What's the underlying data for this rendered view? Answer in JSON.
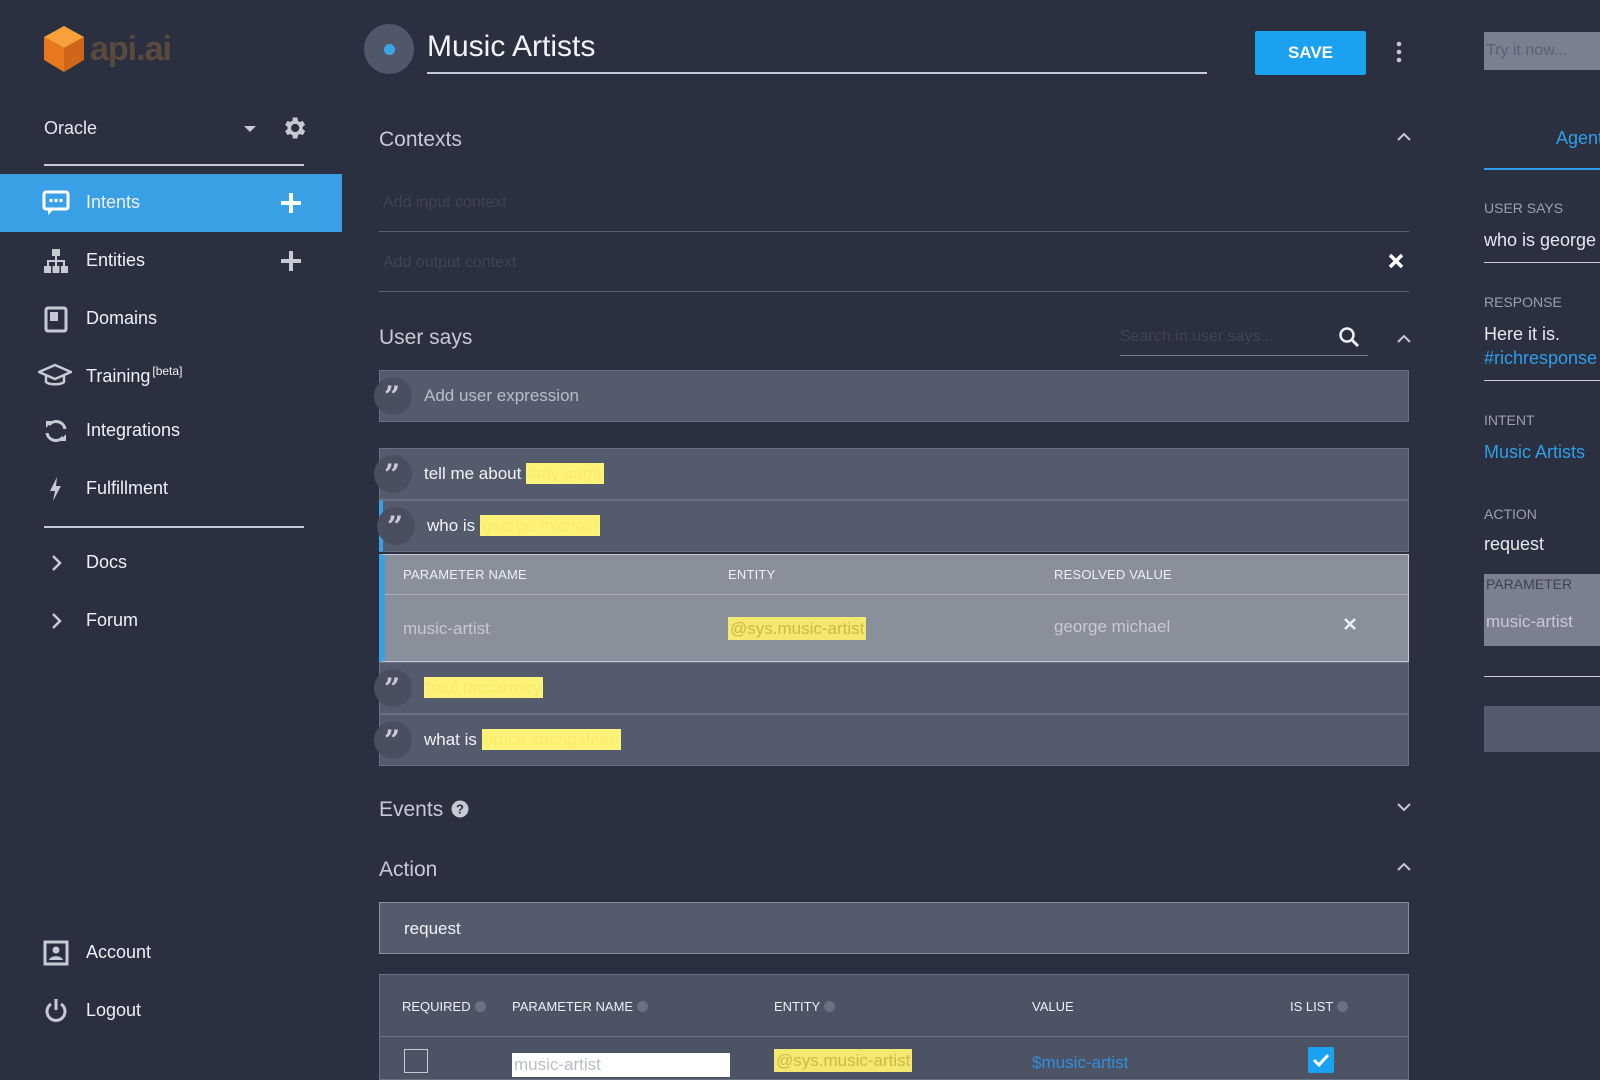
{
  "brand": {
    "logo_text": "api.ai",
    "accent": "#39a0e5",
    "save_color": "#1aa1ef",
    "highlight": "#fdf27a"
  },
  "sidebar": {
    "agent_name": "Oracle",
    "items": [
      {
        "label": "Intents",
        "icon": "intents-icon",
        "active": true
      },
      {
        "label": "Entities",
        "icon": "entities-icon"
      },
      {
        "label": "Domains",
        "icon": "domains-icon"
      },
      {
        "label": "Training",
        "badge": "[beta]",
        "icon": "training-icon"
      },
      {
        "label": "Integrations",
        "icon": "integrations-icon"
      },
      {
        "label": "Fulfillment",
        "icon": "fulfillment-icon"
      },
      {
        "label": "Docs",
        "icon": "chevron-right-icon"
      },
      {
        "label": "Forum",
        "icon": "chevron-right-icon"
      },
      {
        "label": "Account",
        "icon": "account-icon"
      },
      {
        "label": "Logout",
        "icon": "power-icon"
      }
    ]
  },
  "header": {
    "intent_name": "Music Artists",
    "save_label": "SAVE"
  },
  "contexts": {
    "title": "Contexts",
    "input_placeholder": "Add input context",
    "output_placeholder": "Add output context"
  },
  "user_says": {
    "title": "User says",
    "search_placeholder": "Search in user says...",
    "add_placeholder": "Add user expression",
    "expressions": [
      {
        "prefix": "tell me about ",
        "entity": "lady gaga"
      },
      {
        "prefix": "who is ",
        "entity": "george michael"
      },
      {
        "prefix": "",
        "entity": "paul mccartney"
      },
      {
        "prefix": "what is ",
        "entity": "bruce springsteen"
      }
    ],
    "param_table": {
      "headers": [
        "PARAMETER NAME",
        "ENTITY",
        "RESOLVED VALUE"
      ],
      "row": {
        "name": "music-artist",
        "entity": "@sys.music-artist",
        "resolved": "george michael"
      }
    }
  },
  "events": {
    "title": "Events"
  },
  "action": {
    "title": "Action",
    "value": "request",
    "table": {
      "headers": [
        "REQUIRED",
        "PARAMETER NAME",
        "ENTITY",
        "VALUE",
        "IS LIST"
      ],
      "row": {
        "required": false,
        "name": "music-artist",
        "entity": "@sys.music-artist",
        "value": "$music-artist",
        "is_list": true
      }
    }
  },
  "right_panel": {
    "try_placeholder": "Try it now...",
    "tab": "Agent",
    "user_says_label": "USER SAYS",
    "user_says_value": "who is george m",
    "response_label": "RESPONSE",
    "response_text": "Here it is.",
    "response_link": "#richresponse",
    "intent_label": "INTENT",
    "intent_value": "Music Artists",
    "action_label": "ACTION",
    "action_value": "request",
    "parameter_label": "PARAMETER",
    "parameter_value": "music-artist"
  }
}
